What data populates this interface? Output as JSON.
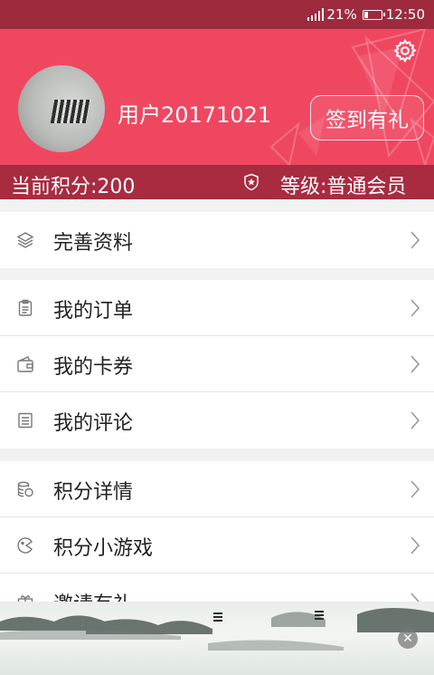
{
  "status_bar": {
    "battery": "21%",
    "time": "12:50"
  },
  "profile": {
    "username": "用户20171021",
    "checkin_label": "签到有礼",
    "points_text": "当前积分:200",
    "level_text": "等级:普通会员"
  },
  "menu": {
    "profile_group": [
      {
        "label": "完善资料",
        "icon": "layers-icon"
      }
    ],
    "orders_group": [
      {
        "label": "我的订单",
        "icon": "clipboard-icon"
      },
      {
        "label": "我的卡券",
        "icon": "wallet-icon"
      },
      {
        "label": "我的评论",
        "icon": "document-icon"
      }
    ],
    "points_group": [
      {
        "label": "积分详情",
        "icon": "coins-icon"
      },
      {
        "label": "积分小游戏",
        "icon": "game-icon"
      },
      {
        "label": "邀请有礼",
        "icon": "gift-icon"
      }
    ]
  },
  "colors": {
    "header": "#ef4760",
    "status_bar": "#9e2a3e",
    "points_bar": "#a82b40"
  }
}
